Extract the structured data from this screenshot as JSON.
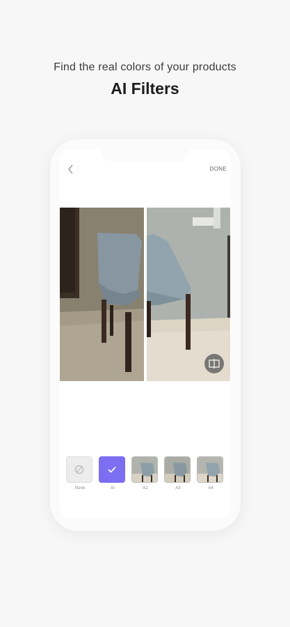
{
  "promo": {
    "subtitle": "Find the real colors of your products",
    "title": "AI Filters"
  },
  "editor": {
    "done_label": "DONE",
    "icons": {
      "back": "chevron-left-icon",
      "compare": "split-compare-icon"
    },
    "filters": [
      {
        "label": "None",
        "state": "none"
      },
      {
        "label": "AI",
        "state": "selected"
      },
      {
        "label": "A2",
        "state": "sample"
      },
      {
        "label": "A3",
        "state": "sample"
      },
      {
        "label": "A4",
        "state": "sample"
      }
    ]
  },
  "colors": {
    "accent": "#7b6ef0",
    "background": "#f7f7f7",
    "chair_fabric_before": "#8a9aa3",
    "chair_fabric_after": "#8fa2ab"
  }
}
